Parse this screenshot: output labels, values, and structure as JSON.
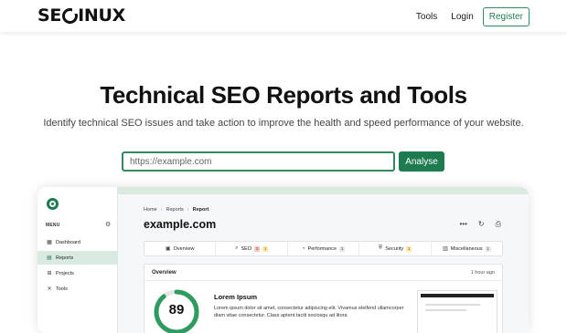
{
  "nav": {
    "logo_text_left": "SE",
    "logo_text_right": "INUX",
    "tools": "Tools",
    "login": "Login",
    "register": "Register"
  },
  "hero": {
    "title": "Technical SEO Reports and Tools",
    "subtitle": "Identify technical SEO issues and take action to improve the health and speed performance of your website.",
    "search_placeholder": "https://example.com",
    "analyse_button": "Analyse"
  },
  "preview": {
    "sidebar": {
      "menu_label": "MENU",
      "items": [
        {
          "label": "Dashboard",
          "icon": "dashboard-icon",
          "active": false
        },
        {
          "label": "Reports",
          "icon": "reports-icon",
          "active": true
        },
        {
          "label": "Projects",
          "icon": "projects-icon",
          "active": false
        },
        {
          "label": "Tools",
          "icon": "tools-icon",
          "active": false
        }
      ]
    },
    "breadcrumb": [
      "Home",
      "Reports",
      "Report"
    ],
    "report_title": "example.com",
    "tabs": [
      {
        "label": "Overview",
        "icon": "overview-icon",
        "badges": []
      },
      {
        "label": "SEO",
        "icon": "search-icon",
        "badges": [
          "3",
          "1"
        ]
      },
      {
        "label": "Performance",
        "icon": "performance-icon",
        "badges": [
          "1"
        ]
      },
      {
        "label": "Security",
        "icon": "security-icon",
        "badges": [
          "1"
        ]
      },
      {
        "label": "Miscellaneous",
        "icon": "miscellaneous-icon",
        "badges": [
          "1"
        ]
      }
    ],
    "overview": {
      "title": "Overview",
      "time": "1 hour ago",
      "score": "89",
      "score_fraction": 0.89,
      "heading": "Lorem Ipsum",
      "body": "Lorem ipsum dolor sit amet, consectetur adipiscing elit. Vivamus eleifend ullamcorper diam vitae consectetur. Class aptent taciti sociosqu ad litora"
    }
  },
  "colors": {
    "brand_green": "#1e7a4f",
    "accent_light": "#d9ebe1"
  }
}
